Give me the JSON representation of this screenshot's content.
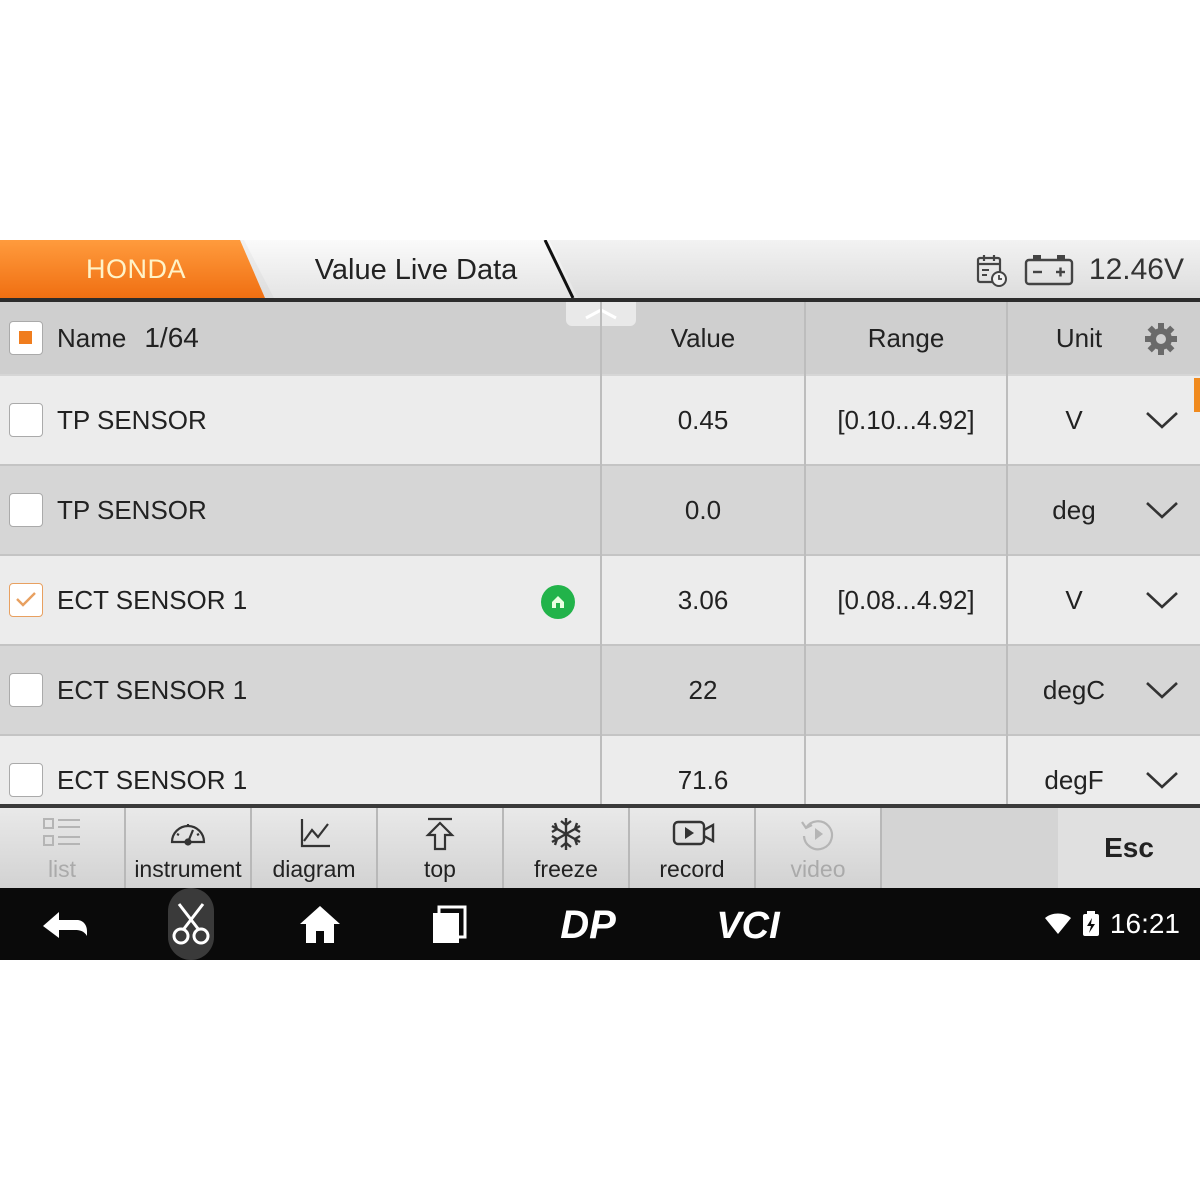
{
  "header": {
    "brand_tab": "HONDA",
    "title_tab": "Value Live Data",
    "voltage": "12.46V",
    "icons": [
      "calendar-clock-icon",
      "battery-icon"
    ]
  },
  "table": {
    "columns": {
      "name": "Name",
      "count": "1/64",
      "value": "Value",
      "range": "Range",
      "unit": "Unit"
    },
    "rows": [
      {
        "name": "TP SENSOR",
        "value": "0.45",
        "range": "[0.10...4.92]",
        "unit": "V",
        "checked": false
      },
      {
        "name": "TP SENSOR",
        "value": "0.0",
        "range": "",
        "unit": "deg",
        "checked": false
      },
      {
        "name": "ECT SENSOR 1",
        "value": "3.06",
        "range": "[0.08...4.92]",
        "unit": "V",
        "checked": true,
        "badge": "green-home-badge"
      },
      {
        "name": "ECT SENSOR 1",
        "value": "22",
        "range": "",
        "unit": "degC",
        "checked": false
      },
      {
        "name": "ECT SENSOR 1",
        "value": "71.6",
        "range": "",
        "unit": "degF",
        "checked": false
      }
    ]
  },
  "toolbar": {
    "list": "list",
    "instrument": "instrument",
    "diagram": "diagram",
    "top": "top",
    "freeze": "freeze",
    "record": "record",
    "video": "video",
    "esc": "Esc"
  },
  "navbar": {
    "logo_dp": "DP",
    "logo_vci": "VCI",
    "time": "16:21"
  },
  "colors": {
    "accent_orange": "#f07d1e",
    "header_text_on_orange": "#fff3c8",
    "navbar_bg": "#0a0a0a",
    "badge_green": "#22b34a"
  }
}
